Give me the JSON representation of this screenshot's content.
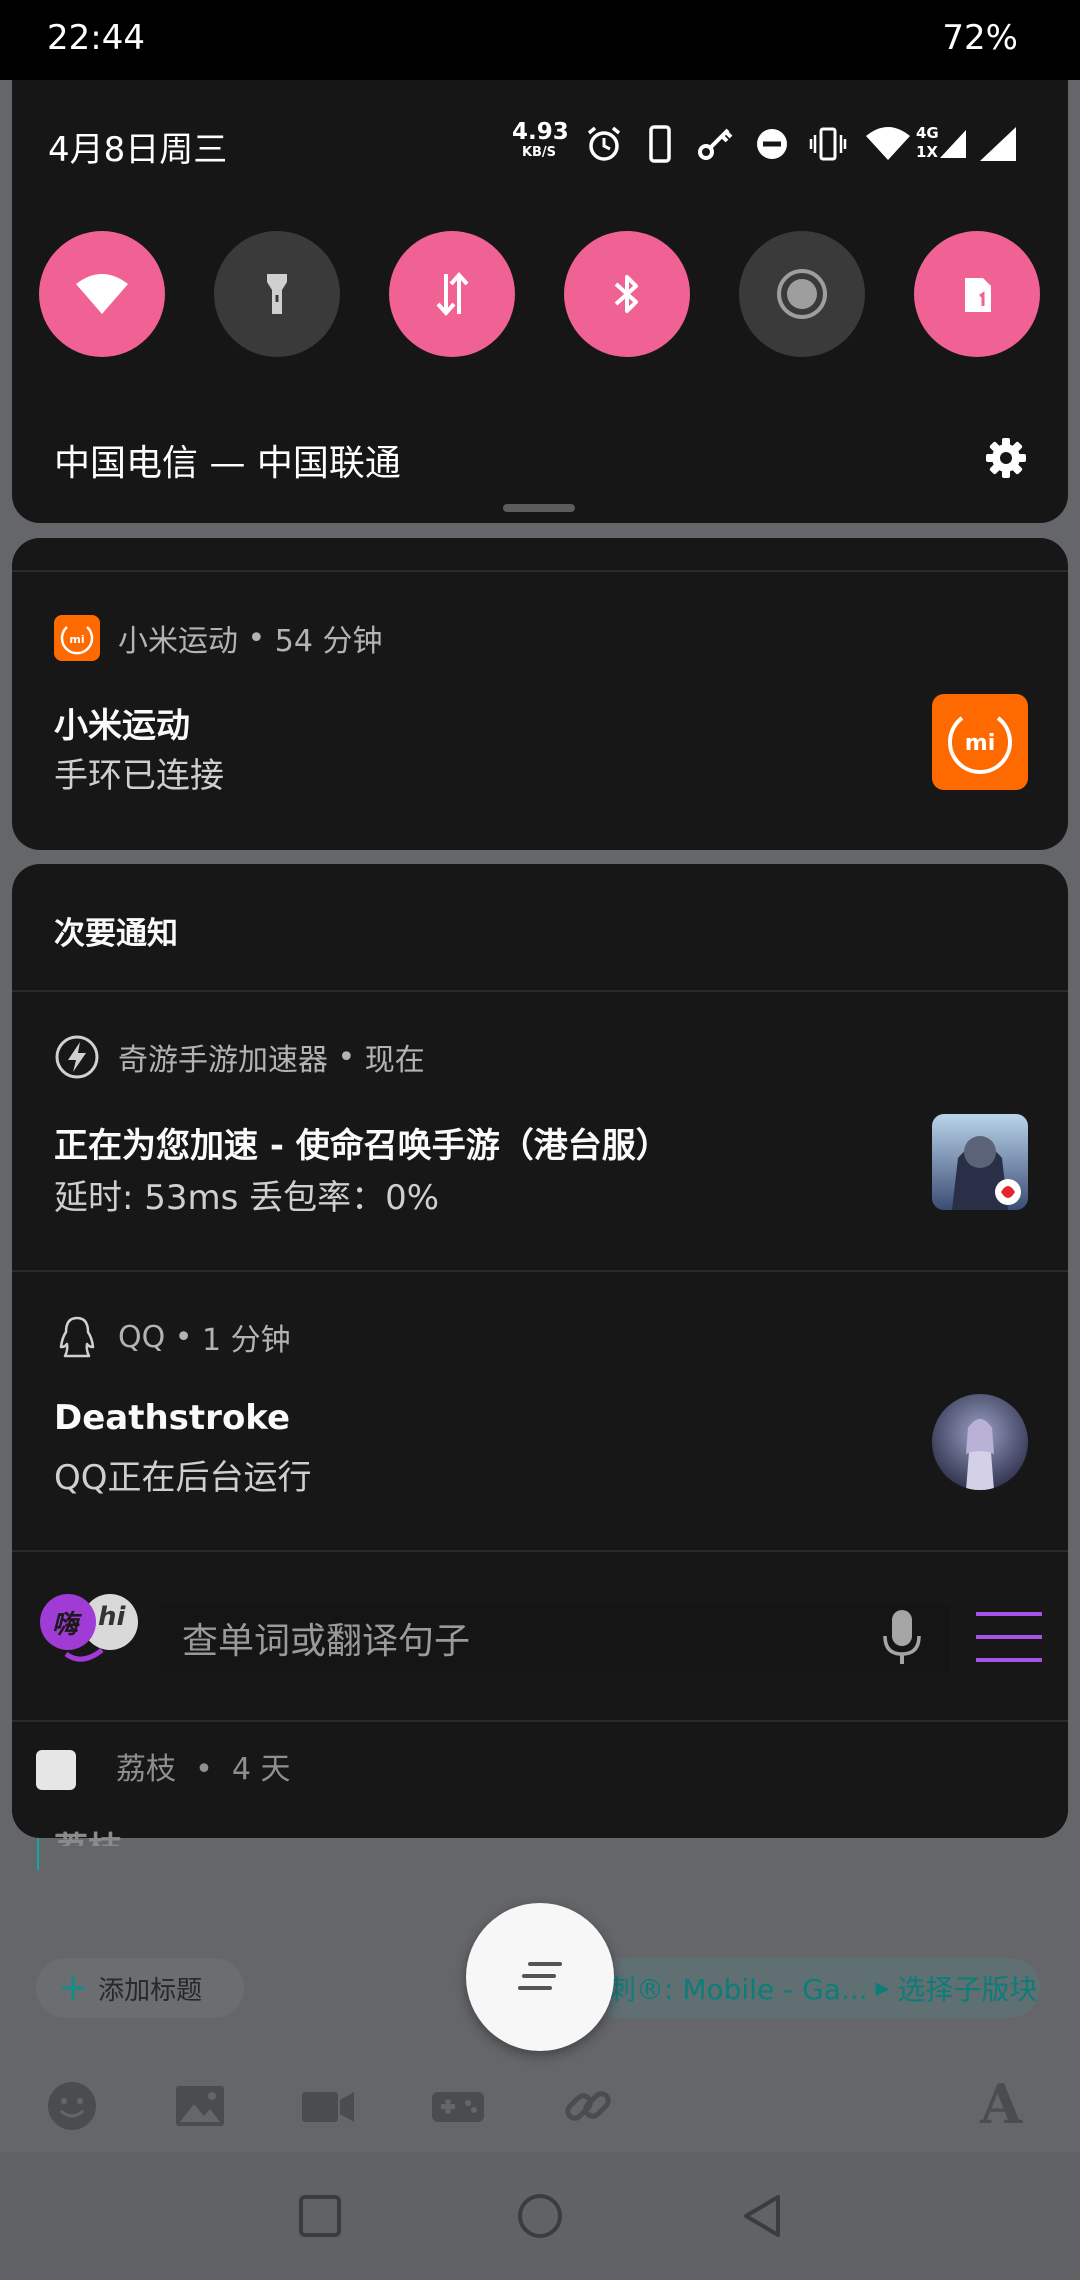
{
  "status_bar": {
    "time": "22:44",
    "battery": "72%"
  },
  "quick_settings": {
    "date": "4月8日周三",
    "net_speed": {
      "value": "4.93",
      "unit": "KB/S"
    },
    "network_label": "4G",
    "network_sub_label": "1X",
    "carrier": "中国电信 — 中国联通",
    "accent_color": "#f06293",
    "tiles": [
      {
        "icon": "wifi-icon",
        "state": "on"
      },
      {
        "icon": "flashlight-icon",
        "state": "off"
      },
      {
        "icon": "mobile-data-icon",
        "state": "on"
      },
      {
        "icon": "bluetooth-icon",
        "state": "on"
      },
      {
        "icon": "screen-record-icon",
        "state": "off"
      },
      {
        "icon": "sim-card-icon",
        "state": "on"
      }
    ]
  },
  "notifications": {
    "mi_fit": {
      "app": "小米运动",
      "time": "54 分钟",
      "title": "小米运动",
      "text": "手环已连接",
      "brand_color": "#ff6a00"
    },
    "secondary_header": "次要通知",
    "accelerator": {
      "app": "奇游手游加速器",
      "time": "现在",
      "title": "正在为您加速 - 使命召唤手游（港台服）",
      "text": "延时: 53ms 丢包率：0%"
    },
    "qq": {
      "app": "QQ",
      "time": "1 分钟",
      "title": "Deathstroke",
      "text": "QQ正在后台运行"
    },
    "dictionary": {
      "logo_text_1": "嗨",
      "logo_text_2": "hi",
      "placeholder": "查单词或翻译句子"
    },
    "lychee": {
      "app": "荔枝",
      "time": "4 天",
      "title": "荔枝"
    }
  },
  "background_app": {
    "add_title": "添加标题",
    "forum_tag": "刺®: Mobile - Ga...",
    "choose_subforum": "选择子版块",
    "font_button": "A"
  }
}
